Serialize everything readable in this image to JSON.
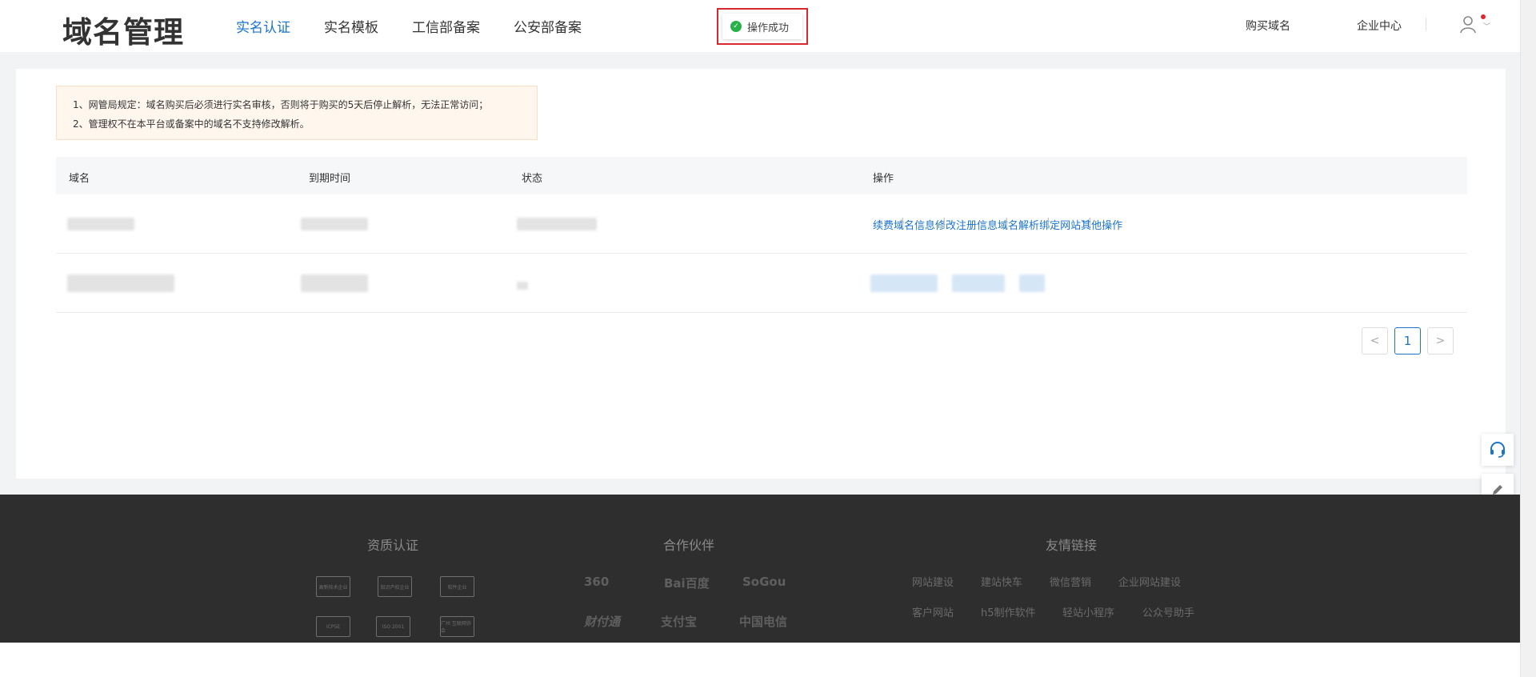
{
  "header": {
    "logo": "域名管理",
    "nav": [
      "实名认证",
      "实名模板",
      "工信部备案",
      "公安部备案"
    ],
    "toast": "操作成功",
    "buy_domain": "购买域名",
    "enterprise_center": "企业中心"
  },
  "notice": {
    "line1": "1、网管局规定：域名购买后必须进行实名审核，否则将于购买的5天后停止解析，无法正常访问；",
    "line2": "2、管理权不在本平台或备案中的域名不支持修改解析。"
  },
  "table": {
    "headers": [
      "域名",
      "到期时间",
      "状态",
      "操作"
    ],
    "row1_ops": [
      "续费",
      "域名信息",
      "修改注册信息",
      "域名解析",
      "绑定网站",
      "其他操作"
    ]
  },
  "pager": {
    "prev": "<",
    "current": "1",
    "next": ">"
  },
  "footer": {
    "cert_title": "资质认证",
    "cert_badges": [
      "高新技术企业",
      "知识产权企业",
      "软件企业",
      "ICPSE",
      "ISO 2001",
      "广州 互联网协会"
    ],
    "partners_title": "合作伙伴",
    "partners": [
      "360",
      "Bai百度",
      "SoGou",
      "财付通",
      "支付宝",
      "中国电信"
    ],
    "links_title": "友情链接",
    "links_row1": [
      "网站建设",
      "建站快车",
      "微信营销",
      "企业网站建设"
    ],
    "links_row2": [
      "客户网站",
      "h5制作软件",
      "轻站小程序",
      "公众号助手"
    ]
  },
  "colors": {
    "accent": "#1a74c9",
    "success": "#27b148",
    "highlight": "#d9272e",
    "footer_bg": "#2e2e2e"
  }
}
